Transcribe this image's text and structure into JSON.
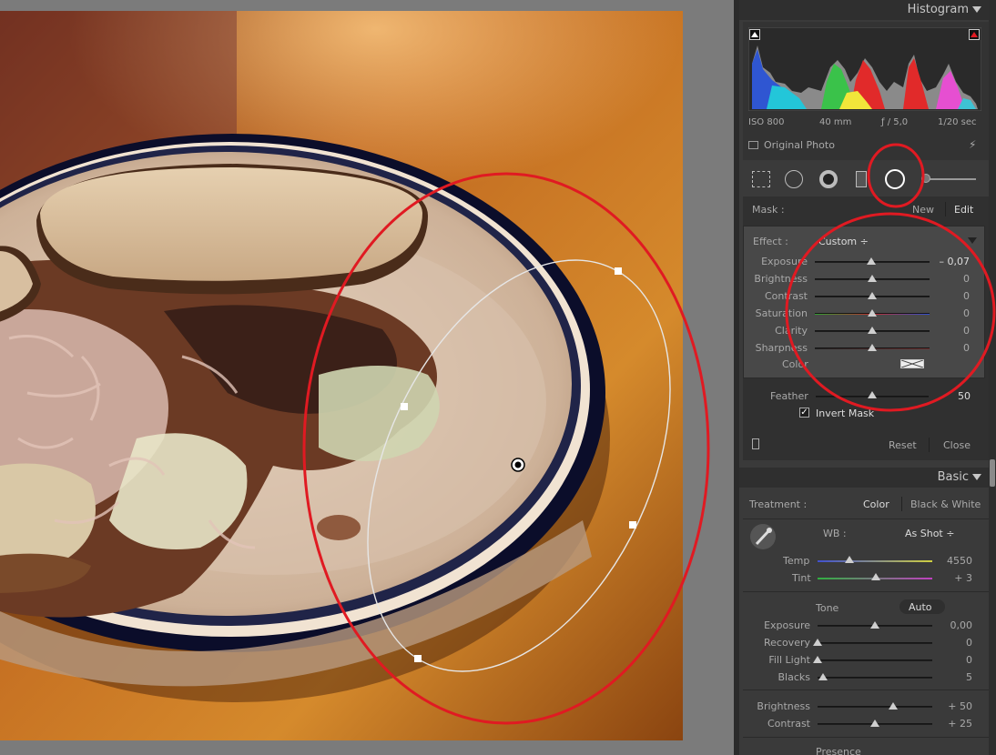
{
  "histogram": {
    "title": "Histogram",
    "iso": "ISO 800",
    "focal": "40 mm",
    "aperture": "ƒ / 5,0",
    "shutter": "1/20 sec",
    "original_photo_label": "Original Photo"
  },
  "mask": {
    "label": "Mask :",
    "new_label": "New",
    "edit_label": "Edit",
    "effect_label": "Effect :",
    "effect_value": "Custom ÷",
    "sliders": [
      {
        "label": "Exposure",
        "value": "– 0,07",
        "level": 0.49
      },
      {
        "label": "Brightness",
        "value": "0",
        "level": 0.5
      },
      {
        "label": "Contrast",
        "value": "0",
        "level": 0.5
      },
      {
        "label": "Saturation",
        "value": "0",
        "level": 0.5
      },
      {
        "label": "Clarity",
        "value": "0",
        "level": 0.5
      },
      {
        "label": "Sharpness",
        "value": "0",
        "level": 0.5
      }
    ],
    "color_label": "Color",
    "feather_label": "Feather",
    "feather_value": "50",
    "feather_level": 0.5,
    "invert_label": "Invert Mask",
    "reset_label": "Reset",
    "close_label": "Close"
  },
  "basic": {
    "title": "Basic",
    "treatment_label": "Treatment :",
    "color_label": "Color",
    "bw_label": "Black & White",
    "wb_label": "WB :",
    "wb_value": "As Shot ÷",
    "temp_label": "Temp",
    "temp_value": "4550",
    "temp_level": 0.28,
    "tint_label": "Tint",
    "tint_value": "+ 3",
    "tint_level": 0.51,
    "tone_label": "Tone",
    "auto_label": "Auto",
    "sliders": [
      {
        "label": "Exposure",
        "value": "0,00",
        "level": 0.5
      },
      {
        "label": "Recovery",
        "value": "0",
        "level": 0.0
      },
      {
        "label": "Fill Light",
        "value": "0",
        "level": 0.0
      },
      {
        "label": "Blacks",
        "value": "5",
        "level": 0.05
      }
    ],
    "sliders2": [
      {
        "label": "Brightness",
        "value": "+ 50",
        "level": 0.66
      },
      {
        "label": "Contrast",
        "value": "+ 25",
        "level": 0.5
      }
    ],
    "presence_label": "Presence"
  },
  "colors": {
    "annotation": "#e01a22",
    "panel": "#3a3a3a"
  }
}
